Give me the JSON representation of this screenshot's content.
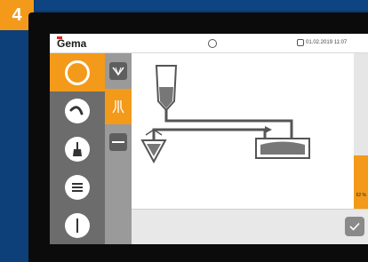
{
  "step": {
    "number": "4"
  },
  "header": {
    "logo": "Gema",
    "datetime": "01.02.2019 11:07"
  },
  "nav": {
    "items": [
      {
        "icon": "ring-icon",
        "active": true
      },
      {
        "icon": "hose-icon",
        "active": false
      },
      {
        "icon": "brush-icon",
        "active": false
      },
      {
        "icon": "menu-icon",
        "active": false
      },
      {
        "icon": "vertical-line-icon",
        "active": false
      }
    ]
  },
  "subnav": {
    "items": [
      {
        "icon": "spray-pattern-icon",
        "active": false
      },
      {
        "icon": "airflow-icon",
        "active": true
      },
      {
        "icon": "nozzle-icon",
        "active": false
      }
    ]
  },
  "level": {
    "percent": 62,
    "label": "62 %"
  },
  "colors": {
    "accent": "#f39a1a",
    "sidebar": "#6c6c6c",
    "subnav": "#9a9a9a"
  }
}
